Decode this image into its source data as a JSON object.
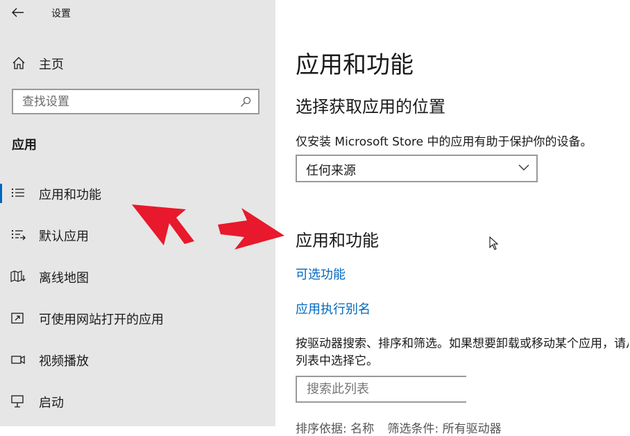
{
  "window": {
    "title": "设置"
  },
  "sidebar": {
    "home_label": "主页",
    "search_placeholder": "查找设置",
    "section_title": "应用",
    "items": [
      {
        "label": "应用和功能",
        "icon": "apps-list-icon",
        "active": true
      },
      {
        "label": "默认应用",
        "icon": "default-apps-icon",
        "active": false
      },
      {
        "label": "离线地图",
        "icon": "offline-map-icon",
        "active": false
      },
      {
        "label": "可使用网站打开的应用",
        "icon": "website-apps-icon",
        "active": false
      },
      {
        "label": "视频播放",
        "icon": "video-playback-icon",
        "active": false
      },
      {
        "label": "启动",
        "icon": "startup-icon",
        "active": false
      }
    ]
  },
  "main": {
    "page_title": "应用和功能",
    "install_section_title": "选择获取应用的位置",
    "install_description": "仅安装 Microsoft Store 中的应用有助于保护你的设备。",
    "source_dropdown_value": "任何来源",
    "apps_section_title": "应用和功能",
    "optional_features_link": "可选功能",
    "app_aliases_link": "应用执行别名",
    "apps_paragraph_line1": "按驱动器搜索、排序和筛选。如果想要卸载或移动某个应用，请从",
    "apps_paragraph_line2": "列表中选择它。",
    "list_search_placeholder": "搜索此列表",
    "sort_row": [
      "排序依据: 名称",
      "筛选条件: 所有驱动器"
    ]
  },
  "colors": {
    "sidebar_bg": "#e6e6e6",
    "accent": "#0067c0",
    "annotation_arrow": "#e8192c"
  }
}
